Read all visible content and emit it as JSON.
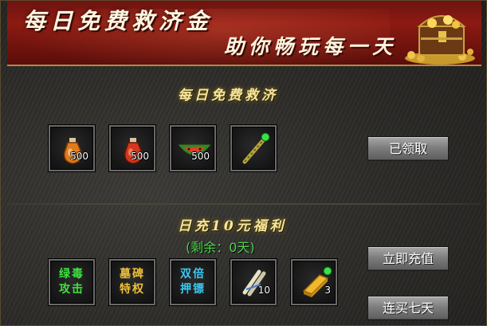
{
  "banner": {
    "title": "每日免费救济金",
    "subtitle": "助你畅玩每一天"
  },
  "daily_relief": {
    "title": "每日免费救济",
    "items": [
      {
        "icon": "hp-potion-icon",
        "count": "500"
      },
      {
        "icon": "mp-potion-icon",
        "count": "500"
      },
      {
        "icon": "watermelon-icon",
        "count": "500"
      },
      {
        "icon": "firework-wand-icon",
        "count": ""
      }
    ],
    "claim_button": "已领取"
  },
  "daily_recharge": {
    "title": "日充10元福利",
    "remaining": "(剩余：0天)",
    "items": [
      {
        "icon": "poison-attack-badge-icon",
        "label_line1": "绿毒",
        "label_line2": "攻击",
        "color": "#3fe23f"
      },
      {
        "icon": "tombstone-privilege-badge-icon",
        "label_line1": "墓碑",
        "label_line2": "特权",
        "color": "#f2c23a"
      },
      {
        "icon": "double-exp-badge-icon",
        "label_line1": "双倍",
        "label_line2": "押镖",
        "color": "#3cc8f0"
      },
      {
        "icon": "scroll-bundle-icon",
        "count": "10"
      },
      {
        "icon": "gold-bar-icon",
        "count": "3"
      }
    ],
    "recharge_button": "立即充值",
    "seven_day_button": "连买七天"
  }
}
